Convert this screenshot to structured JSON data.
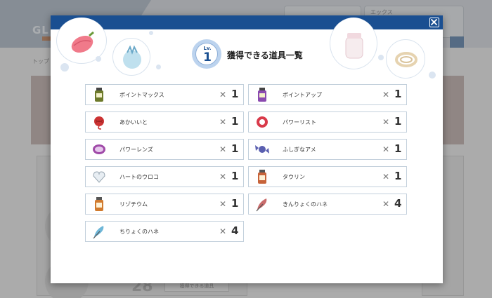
{
  "background": {
    "logo_text": "GL",
    "chip_text": "エックス",
    "breadcrumb": "トップ",
    "button_label": "獲得できる道具",
    "big_number": "28"
  },
  "nav": {
    "prev": "<",
    "next": ">"
  },
  "modal": {
    "level_label": "Lv.",
    "level_value": "1",
    "title": "獲得できる道具一覧",
    "items": [
      {
        "name": "ポイントマックス",
        "x": "✕",
        "qty": "1",
        "icon": "bottle-icon",
        "col": 0,
        "row": 0
      },
      {
        "name": "ポイントアップ",
        "x": "✕",
        "qty": "1",
        "icon": "bottle-icon",
        "col": 1,
        "row": 0
      },
      {
        "name": "あかいいと",
        "x": "✕",
        "qty": "1",
        "icon": "red-string-icon",
        "col": 0,
        "row": 1
      },
      {
        "name": "パワーリスト",
        "x": "✕",
        "qty": "1",
        "icon": "power-bracer-icon",
        "col": 1,
        "row": 1
      },
      {
        "name": "パワーレンズ",
        "x": "✕",
        "qty": "1",
        "icon": "power-lens-icon",
        "col": 0,
        "row": 2
      },
      {
        "name": "ふしぎなアメ",
        "x": "✕",
        "qty": "1",
        "icon": "rare-candy-icon",
        "col": 1,
        "row": 2
      },
      {
        "name": "ハートのウロコ",
        "x": "✕",
        "qty": "1",
        "icon": "heart-scale-icon",
        "col": 0,
        "row": 3
      },
      {
        "name": "タウリン",
        "x": "✕",
        "qty": "1",
        "icon": "vitamin-bottle-icon",
        "col": 1,
        "row": 3
      },
      {
        "name": "リゾチウム",
        "x": "✕",
        "qty": "1",
        "icon": "vitamin-bottle-icon",
        "col": 0,
        "row": 4
      },
      {
        "name": "きんりょくのハネ",
        "x": "✕",
        "qty": "4",
        "icon": "feather-icon",
        "col": 1,
        "row": 4
      },
      {
        "name": "ちりょくのハネ",
        "x": "✕",
        "qty": "4",
        "icon": "feather-icon",
        "col": 0,
        "row": 5
      }
    ]
  },
  "colors": {
    "modal_bar": "#1a4f91",
    "card_border": "#c3d0dc",
    "pp_max": "#6d7a2a",
    "pp_up": "#8a4ab0",
    "red_string": "#c33",
    "power_bracer": "#d93a4a",
    "power_lens": "#a04aa8",
    "rare_candy": "#5a5fb0",
    "heart_scale": "#e8eef3",
    "taurine": "#c7633a",
    "zinc": "#d17a2d",
    "muscle_feather": "#c96b6b",
    "genius_feather": "#6fb7d8"
  }
}
